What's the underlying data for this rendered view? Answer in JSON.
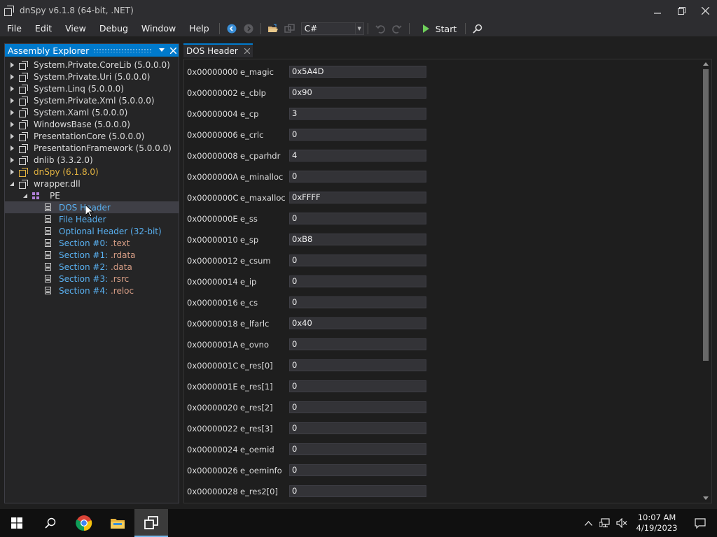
{
  "window": {
    "title": "dnSpy v6.1.8 (64-bit, .NET)",
    "minimize": "🗕",
    "maximize": "🗗",
    "close": "✕"
  },
  "menu": {
    "items": [
      "File",
      "Edit",
      "View",
      "Debug",
      "Window",
      "Help"
    ]
  },
  "toolbar": {
    "language": "C#",
    "start_label": "Start"
  },
  "explorer": {
    "title": "Assembly Explorer",
    "assemblies": [
      "System.Private.CoreLib (5.0.0.0)",
      "System.Private.Uri (5.0.0.0)",
      "System.Linq (5.0.0.0)",
      "System.Private.Xml (5.0.0.0)",
      "System.Xaml (5.0.0.0)",
      "WindowsBase (5.0.0.0)",
      "PresentationCore (5.0.0.0)",
      "PresentationFramework (5.0.0.0)",
      "dnlib (3.3.2.0)",
      "dnSpy (6.1.8.0)",
      "wrapper.dll"
    ],
    "pe_label": "PE",
    "pe_children": [
      "DOS Header",
      "File Header",
      "Optional Header (32-bit)",
      "Section #0: .text",
      "Section #1: .rdata",
      "Section #2: .data",
      "Section #3: .rsrc",
      "Section #4: .reloc"
    ]
  },
  "tab": {
    "title": "DOS Header",
    "close": "✕"
  },
  "dos_header": {
    "rows": [
      {
        "offset": "0x00000000",
        "name": "e_magic",
        "value": "0x5A4D"
      },
      {
        "offset": "0x00000002",
        "name": "e_cblp",
        "value": "0x90"
      },
      {
        "offset": "0x00000004",
        "name": "e_cp",
        "value": "3"
      },
      {
        "offset": "0x00000006",
        "name": "e_crlc",
        "value": "0"
      },
      {
        "offset": "0x00000008",
        "name": "e_cparhdr",
        "value": "4"
      },
      {
        "offset": "0x0000000A",
        "name": "e_minalloc",
        "value": "0"
      },
      {
        "offset": "0x0000000C",
        "name": "e_maxalloc",
        "value": "0xFFFF"
      },
      {
        "offset": "0x0000000E",
        "name": "e_ss",
        "value": "0"
      },
      {
        "offset": "0x00000010",
        "name": "e_sp",
        "value": "0xB8"
      },
      {
        "offset": "0x00000012",
        "name": "e_csum",
        "value": "0"
      },
      {
        "offset": "0x00000014",
        "name": "e_ip",
        "value": "0"
      },
      {
        "offset": "0x00000016",
        "name": "e_cs",
        "value": "0"
      },
      {
        "offset": "0x00000018",
        "name": "e_lfarlc",
        "value": "0x40"
      },
      {
        "offset": "0x0000001A",
        "name": "e_ovno",
        "value": "0"
      },
      {
        "offset": "0x0000001C",
        "name": "e_res[0]",
        "value": "0"
      },
      {
        "offset": "0x0000001E",
        "name": "e_res[1]",
        "value": "0"
      },
      {
        "offset": "0x00000020",
        "name": "e_res[2]",
        "value": "0"
      },
      {
        "offset": "0x00000022",
        "name": "e_res[3]",
        "value": "0"
      },
      {
        "offset": "0x00000024",
        "name": "e_oemid",
        "value": "0"
      },
      {
        "offset": "0x00000026",
        "name": "e_oeminfo",
        "value": "0"
      },
      {
        "offset": "0x00000028",
        "name": "e_res2[0]",
        "value": "0"
      }
    ]
  },
  "taskbar": {
    "time": "10:07 AM",
    "date": "4/19/2023"
  },
  "colors": {
    "accent": "#007acc",
    "tree_link": "#59b0f0",
    "section_orange": "#d69d85",
    "dnspy_gold": "#e3b341"
  }
}
